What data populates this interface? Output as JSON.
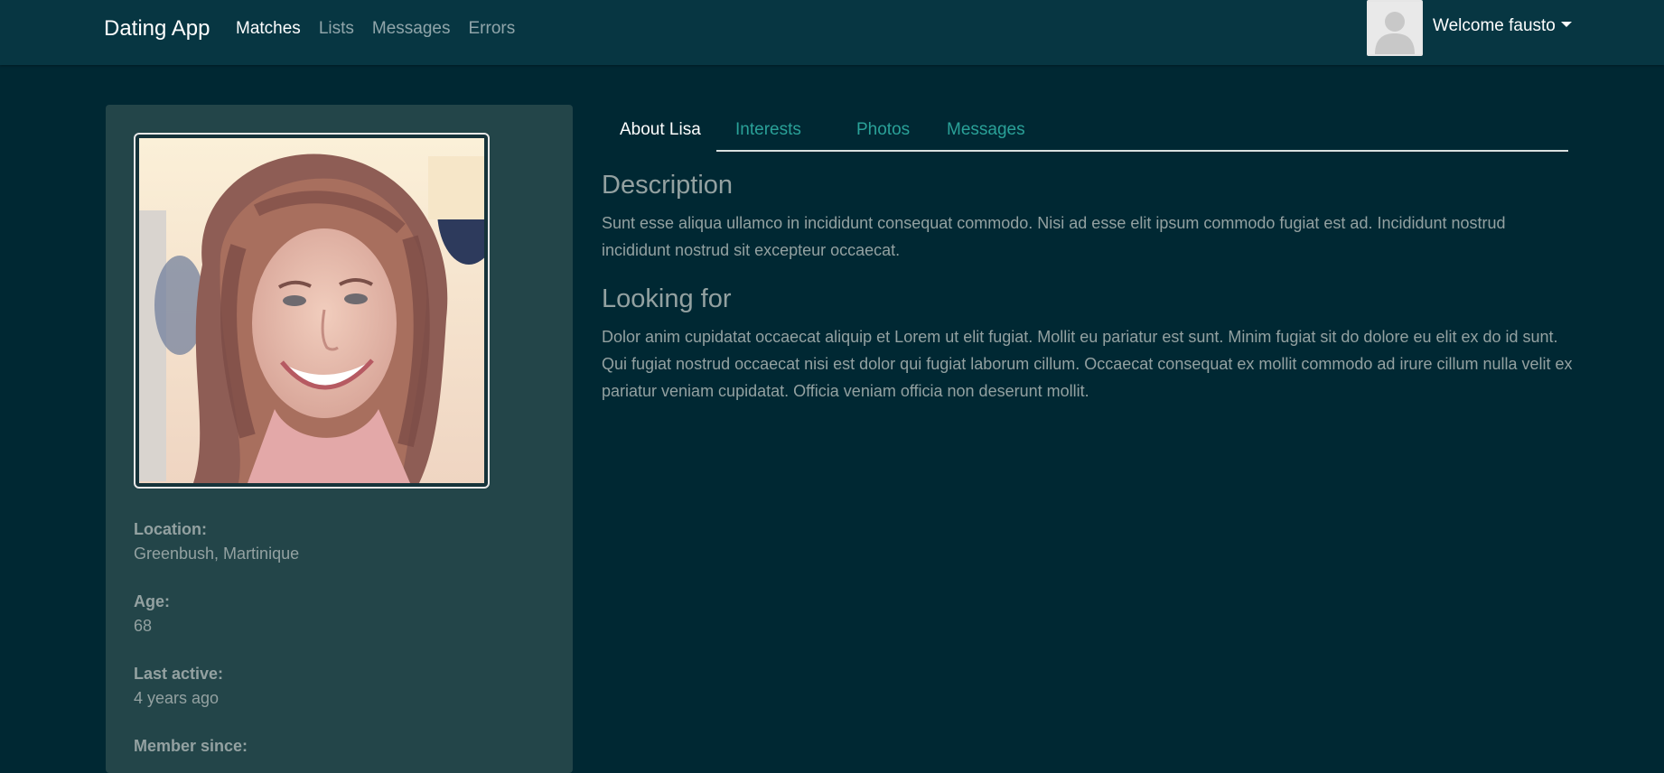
{
  "navbar": {
    "brand": "Dating App",
    "links": [
      {
        "label": "Matches",
        "active": true
      },
      {
        "label": "Lists",
        "active": false
      },
      {
        "label": "Messages",
        "active": false
      },
      {
        "label": "Errors",
        "active": false
      }
    ],
    "welcome": "Welcome fausto"
  },
  "profile": {
    "location_label": "Location:",
    "location": "Greenbush, Martinique",
    "age_label": "Age:",
    "age": "68",
    "last_active_label": "Last active:",
    "last_active": "4 years ago",
    "member_since_label": "Member since:"
  },
  "tabs": [
    {
      "label": "About Lisa",
      "active": true
    },
    {
      "label": "Interests",
      "active": false
    },
    {
      "label": "Photos",
      "active": false
    },
    {
      "label": "Messages",
      "active": false
    }
  ],
  "about": {
    "description_title": "Description",
    "description": "Sunt esse aliqua ullamco in incididunt consequat commodo. Nisi ad esse elit ipsum commodo fugiat est ad. Incididunt nostrud incididunt nostrud sit excepteur occaecat.",
    "looking_for_title": "Looking for",
    "looking_for": "Dolor anim cupidatat occaecat aliquip et Lorem ut elit fugiat. Mollit eu pariatur est sunt. Minim fugiat sit do dolore eu elit ex do id sunt. Qui fugiat nostrud occaecat nisi est dolor qui fugiat laborum cillum. Occaecat consequat ex mollit commodo ad irure cillum nulla velit ex pariatur veniam cupidatat. Officia veniam officia non deserunt mollit."
  },
  "colors": {
    "page_bg": "#002833",
    "navbar_bg": "#073642",
    "card_bg": "#234549",
    "accent": "#2aa198",
    "muted_text": "#93a1a1"
  },
  "icons": {
    "user_avatar": "user-placeholder-icon",
    "dropdown": "caret-down-icon"
  }
}
